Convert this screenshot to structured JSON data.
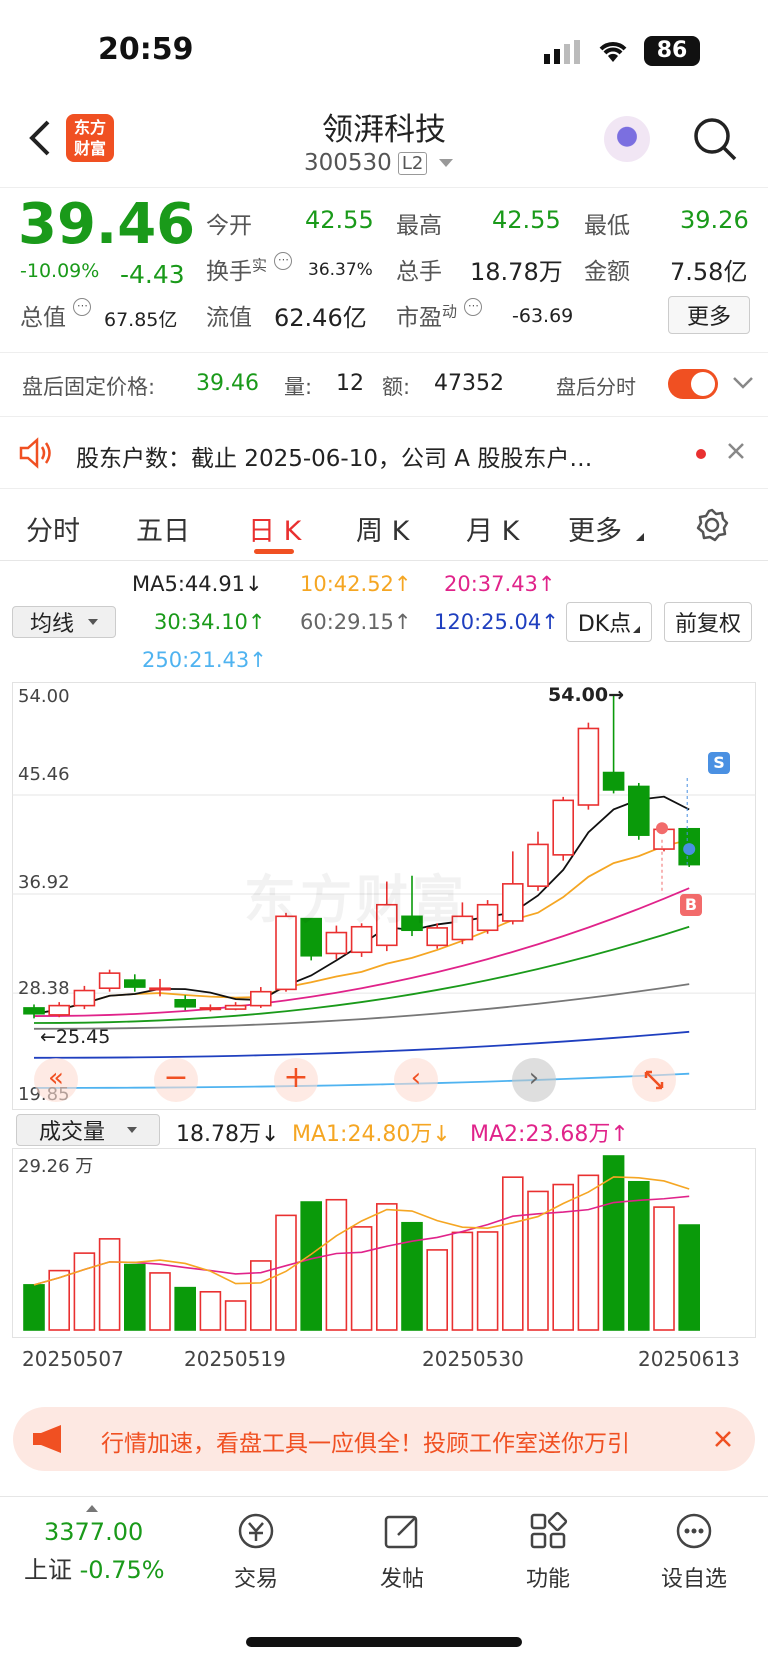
{
  "status": {
    "time": "20:59",
    "battery": "86"
  },
  "nav": {
    "title": "领湃科技",
    "code": "300530",
    "level": "L2",
    "logo_line1": "东方",
    "logo_line2": "财富"
  },
  "quote": {
    "price": "39.46",
    "change_pct": "-10.09%",
    "change": "-4.43",
    "open_label": "今开",
    "open": "42.55",
    "high_label": "最高",
    "high": "42.55",
    "low_label": "最低",
    "low": "39.26",
    "turnover_label": "换手",
    "turnover_sup": "实",
    "turnover": "36.37%",
    "volume_label": "总手",
    "volume": "18.78万",
    "amount_label": "金额",
    "amount": "7.58亿",
    "mktcap_label": "总值",
    "mktcap": "67.85亿",
    "float_label": "流值",
    "float": "62.46亿",
    "pe_label": "市盈",
    "pe_sup": "动",
    "pe": "-63.69",
    "more_label": "更多"
  },
  "after_hours": {
    "price_label": "盘后固定价格:",
    "price": "39.46",
    "vol_label": "量:",
    "vol": "12",
    "amt_label": "额:",
    "amt": "47352",
    "toggle_label": "盘后分时"
  },
  "notice": {
    "text": "股东户数：截止 2025-06-10，公司 A 股股东户…"
  },
  "tabs": [
    "分时",
    "五日",
    "日 K",
    "周 K",
    "月 K",
    "更多"
  ],
  "ma": {
    "ma5": "MA5:44.91↓",
    "ma10": "10:42.52↑",
    "ma20": "20:37.43↑",
    "ma30": "30:34.10↑",
    "ma60": "60:29.15↑",
    "ma120": "120:25.04↑",
    "ma250": "250:21.43↑",
    "selector": "均线",
    "dk": "DK点",
    "adjust": "前复权"
  },
  "chart": {
    "y_ticks": [
      "54.00",
      "45.46",
      "36.92",
      "28.38",
      "19.85"
    ],
    "max_label": "54.00→",
    "min_label": "←25.45",
    "watermark": "东方财富",
    "s_label": "S",
    "b_label": "B"
  },
  "volume": {
    "selector": "成交量",
    "current": "18.78万↓",
    "ma1": "MA1:24.80万↓",
    "ma2": "MA2:23.68万↑",
    "top_label": "29.26 万",
    "dates": [
      "20250507",
      "20250519",
      "20250530",
      "20250613"
    ]
  },
  "chart_data": {
    "type": "candlestick",
    "ylim": [
      19.85,
      54.0
    ],
    "candles": [
      {
        "o": 27.1,
        "c": 26.6,
        "h": 27.4,
        "l": 26.2
      },
      {
        "o": 26.5,
        "c": 27.3,
        "h": 27.6,
        "l": 26.3
      },
      {
        "o": 27.3,
        "c": 28.6,
        "h": 29.0,
        "l": 27.0
      },
      {
        "o": 28.8,
        "c": 30.1,
        "h": 30.4,
        "l": 28.5
      },
      {
        "o": 29.5,
        "c": 28.9,
        "h": 30.0,
        "l": 28.5
      },
      {
        "o": 28.8,
        "c": 28.8,
        "h": 29.6,
        "l": 28.1
      },
      {
        "o": 27.8,
        "c": 27.2,
        "h": 28.2,
        "l": 26.9
      },
      {
        "o": 27.0,
        "c": 27.1,
        "h": 27.4,
        "l": 26.8
      },
      {
        "o": 27.0,
        "c": 27.3,
        "h": 27.6,
        "l": 26.9
      },
      {
        "o": 27.3,
        "c": 28.5,
        "h": 28.9,
        "l": 27.1
      },
      {
        "o": 28.7,
        "c": 35.0,
        "h": 35.3,
        "l": 28.5
      },
      {
        "o": 34.8,
        "c": 31.6,
        "h": 34.8,
        "l": 31.2
      },
      {
        "o": 31.8,
        "c": 33.6,
        "h": 34.2,
        "l": 31.3
      },
      {
        "o": 31.9,
        "c": 34.1,
        "h": 34.4,
        "l": 31.5
      },
      {
        "o": 32.5,
        "c": 36.0,
        "h": 38.0,
        "l": 32.0
      },
      {
        "o": 35.0,
        "c": 33.8,
        "h": 38.5,
        "l": 33.3
      },
      {
        "o": 32.5,
        "c": 34.0,
        "h": 34.4,
        "l": 32.2
      },
      {
        "o": 33.0,
        "c": 35.0,
        "h": 36.2,
        "l": 32.6
      },
      {
        "o": 33.8,
        "c": 36.0,
        "h": 36.4,
        "l": 33.5
      },
      {
        "o": 34.6,
        "c": 37.8,
        "h": 40.6,
        "l": 34.3
      },
      {
        "o": 37.6,
        "c": 41.2,
        "h": 42.3,
        "l": 37.2
      },
      {
        "o": 40.3,
        "c": 45.0,
        "h": 45.3,
        "l": 39.8
      },
      {
        "o": 44.6,
        "c": 51.2,
        "h": 51.7,
        "l": 44.2
      },
      {
        "o": 47.4,
        "c": 45.9,
        "h": 54.0,
        "l": 45.6
      },
      {
        "o": 46.2,
        "c": 42.0,
        "h": 46.5,
        "l": 41.6
      },
      {
        "o": 40.8,
        "c": 42.5,
        "h": 42.8,
        "l": 40.6
      },
      {
        "o": 42.55,
        "c": 39.46,
        "h": 42.55,
        "l": 39.26
      }
    ],
    "volumes": [
      9.8,
      12.9,
      16.7,
      19.8,
      14.2,
      12.4,
      9.2,
      8.3,
      6.3,
      15.0,
      24.9,
      27.8,
      28.3,
      22.4,
      27.4,
      23.3,
      17.4,
      21.2,
      21.3,
      33.2,
      30.1,
      31.6,
      33.6,
      37.8,
      32.2,
      26.7,
      22.8
    ],
    "volume_max": 37.8
  }
}
